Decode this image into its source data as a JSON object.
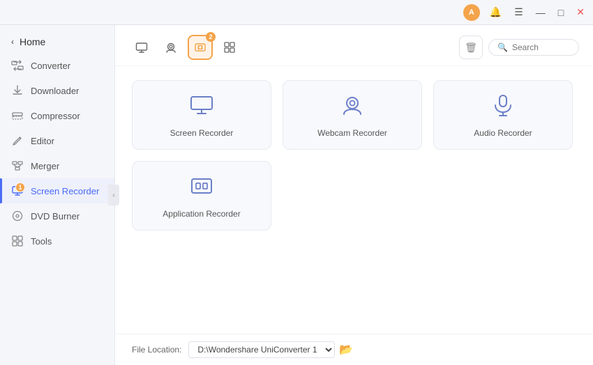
{
  "titlebar": {
    "avatar_label": "A",
    "bell_icon": "🔔",
    "menu_icon": "☰",
    "minimize_icon": "—",
    "maximize_icon": "□",
    "close_icon": "✕"
  },
  "sidebar": {
    "home_label": "Home",
    "items": [
      {
        "id": "converter",
        "label": "Converter",
        "icon": "⇄",
        "active": false,
        "badge": null
      },
      {
        "id": "downloader",
        "label": "Downloader",
        "icon": "⬇",
        "active": false,
        "badge": null
      },
      {
        "id": "compressor",
        "label": "Compressor",
        "icon": "⊞",
        "active": false,
        "badge": null
      },
      {
        "id": "editor",
        "label": "Editor",
        "icon": "✂",
        "active": false,
        "badge": null
      },
      {
        "id": "merger",
        "label": "Merger",
        "icon": "⊕",
        "active": false,
        "badge": null
      },
      {
        "id": "screen-recorder",
        "label": "Screen Recorder",
        "icon": "⏺",
        "active": true,
        "badge": "1"
      },
      {
        "id": "dvd-burner",
        "label": "DVD Burner",
        "icon": "⊙",
        "active": false,
        "badge": null
      },
      {
        "id": "tools",
        "label": "Tools",
        "icon": "⊞",
        "active": false,
        "badge": null
      }
    ]
  },
  "toolbar": {
    "tools": [
      {
        "id": "screen",
        "icon": "🖥",
        "active": false,
        "badge": null
      },
      {
        "id": "webcam",
        "icon": "📷",
        "active": false,
        "badge": null
      },
      {
        "id": "app-recorder",
        "icon": "👤",
        "active": true,
        "badge": "2"
      },
      {
        "id": "grid",
        "icon": "⊞",
        "active": false,
        "badge": null
      }
    ],
    "delete_icon": "🗑",
    "search_placeholder": "Search"
  },
  "cards": {
    "row1": [
      {
        "id": "screen-recorder",
        "label": "Screen Recorder",
        "icon": "screen"
      },
      {
        "id": "webcam-recorder",
        "label": "Webcam Recorder",
        "icon": "webcam"
      },
      {
        "id": "audio-recorder",
        "label": "Audio Recorder",
        "icon": "audio"
      }
    ],
    "row2": [
      {
        "id": "application-recorder",
        "label": "Application Recorder",
        "icon": "app"
      }
    ]
  },
  "footer": {
    "file_location_label": "File Location:",
    "path_value": "D:\\Wondershare UniConverter 1",
    "folder_icon": "📁"
  }
}
